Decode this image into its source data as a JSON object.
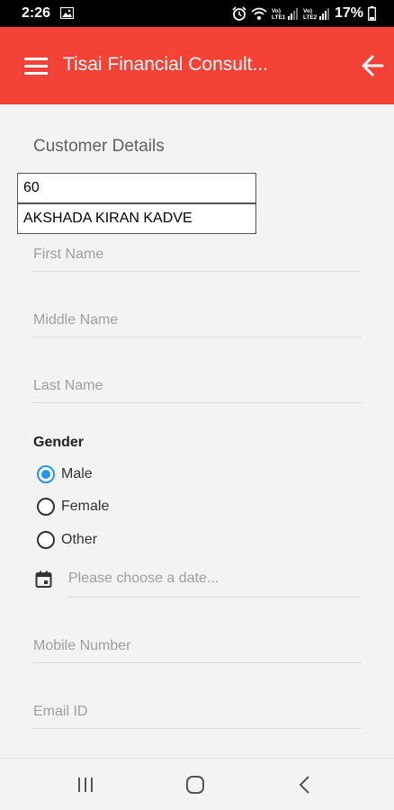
{
  "status_bar": {
    "time": "2:26",
    "battery": "17%",
    "carrier_1": "Vo) LTE1",
    "carrier_2": "Vo) LTE2"
  },
  "app_bar": {
    "title": "Tisai Financial Consult...",
    "accent_color": "#f44336"
  },
  "customer": {
    "section_title": "Customer Details",
    "id_value": "60",
    "name_value": "AKSHADA KIRAN KADVE"
  },
  "fields": {
    "first_name_placeholder": "First Name",
    "middle_name_placeholder": "Middle Name",
    "last_name_placeholder": "Last Name",
    "date_placeholder": "Please choose a date...",
    "mobile_placeholder": "Mobile Number",
    "email_placeholder": "Email ID"
  },
  "gender": {
    "label": "Gender",
    "options": [
      "Male",
      "Female",
      "Other"
    ],
    "selected": "Male",
    "accent_color": "#2196f3"
  },
  "icons": [
    "menu-icon",
    "back-arrow-icon",
    "calendar-icon",
    "recent-apps-icon",
    "home-icon",
    "back-icon"
  ]
}
